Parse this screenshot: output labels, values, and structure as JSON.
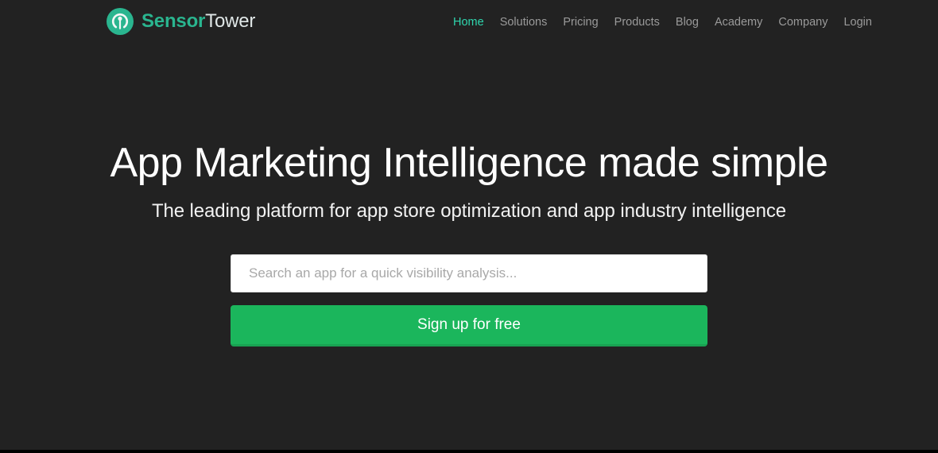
{
  "colors": {
    "page_background": "#222222",
    "brand_teal": "#2ab58f",
    "nav_active": "#2fd6ae",
    "nav_inactive": "#9a9a9a",
    "button_green": "#1bb65c",
    "button_green_shadow": "#19a352",
    "heading_white": "#ffffff",
    "input_background": "#ffffff",
    "placeholder_gray": "#a8a8a8"
  },
  "header": {
    "logo": {
      "icon_name": "sensor-tower-signal-icon",
      "text_primary": "Sensor",
      "text_secondary": "Tower"
    },
    "nav": [
      {
        "label": "Home",
        "active": true
      },
      {
        "label": "Solutions",
        "active": false
      },
      {
        "label": "Pricing",
        "active": false
      },
      {
        "label": "Products",
        "active": false
      },
      {
        "label": "Blog",
        "active": false
      },
      {
        "label": "Academy",
        "active": false
      },
      {
        "label": "Company",
        "active": false
      },
      {
        "label": "Login",
        "active": false
      }
    ]
  },
  "hero": {
    "title": "App Marketing Intelligence made simple",
    "subtitle": "The leading platform for app store optimization and app industry intelligence",
    "search": {
      "placeholder": "Search an app for a quick visibility analysis...",
      "value": ""
    },
    "signup_label": "Sign up for free"
  }
}
